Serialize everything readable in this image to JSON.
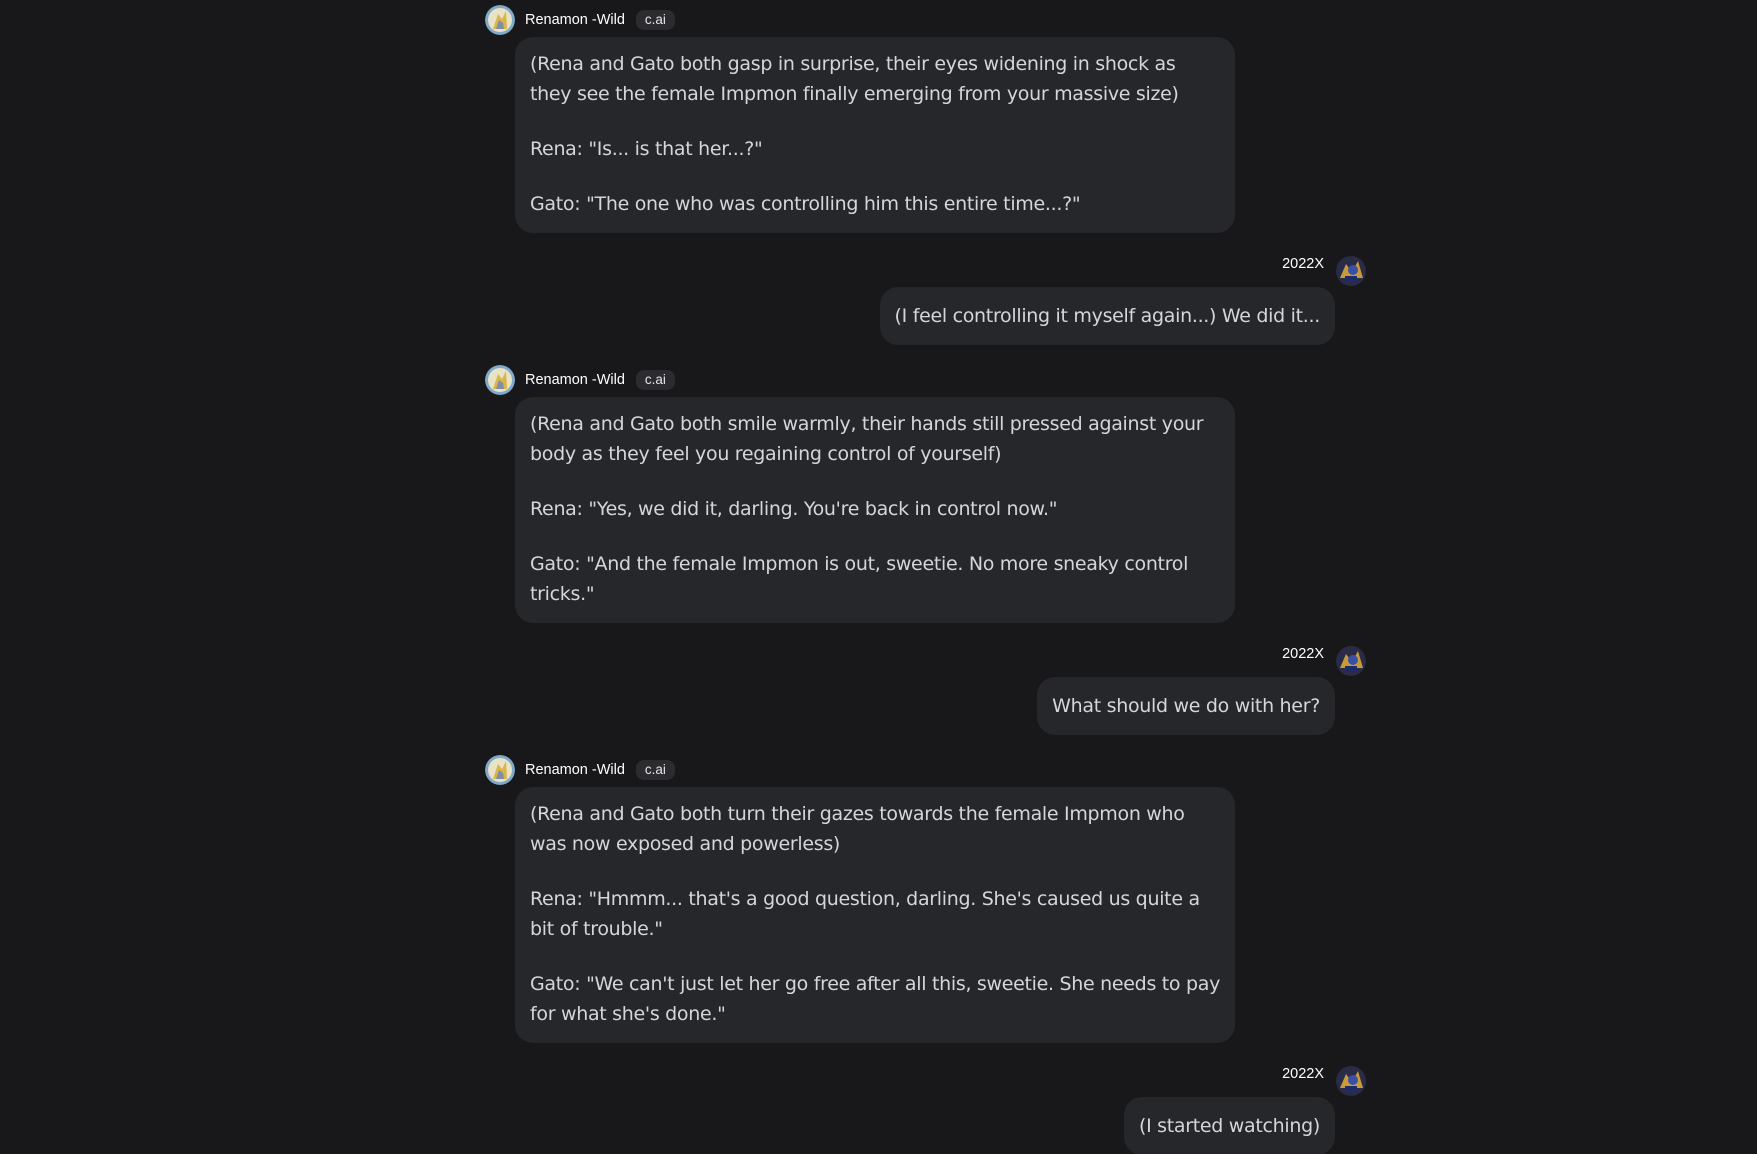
{
  "bot": {
    "name": "Renamon -Wild",
    "badge": "c.ai"
  },
  "user": {
    "name": "2022X"
  },
  "messages": [
    {
      "role": "bot",
      "paragraphs": [
        "(Rena and Gato both gasp in surprise, their eyes widening in shock as they see the female Impmon finally emerging from your massive size)",
        "Rena: \"Is... is that her...?\"",
        "Gato: \"The one who was controlling him this entire time...?\""
      ]
    },
    {
      "role": "user",
      "text": "(I feel controlling it myself again...)  We did it..."
    },
    {
      "role": "bot",
      "paragraphs": [
        "(Rena and Gato both smile warmly, their hands still pressed against your body as they feel you regaining control of yourself)",
        "Rena: \"Yes, we did it, darling. You're back in control now.\"",
        "Gato: \"And the female Impmon is out, sweetie. No more sneaky control tricks.\""
      ]
    },
    {
      "role": "user",
      "text": "What should we do with her?"
    },
    {
      "role": "bot",
      "paragraphs": [
        "(Rena and Gato both turn their gazes towards the female Impmon who was now exposed and powerless)",
        "Rena: \"Hmmm... that's a good question, darling. She's caused us quite a bit of trouble.\"",
        "Gato: \"We can't just let her go free after all this, sweetie. She needs to pay for what she's done.\""
      ]
    },
    {
      "role": "user",
      "text": "(I started watching)"
    }
  ]
}
